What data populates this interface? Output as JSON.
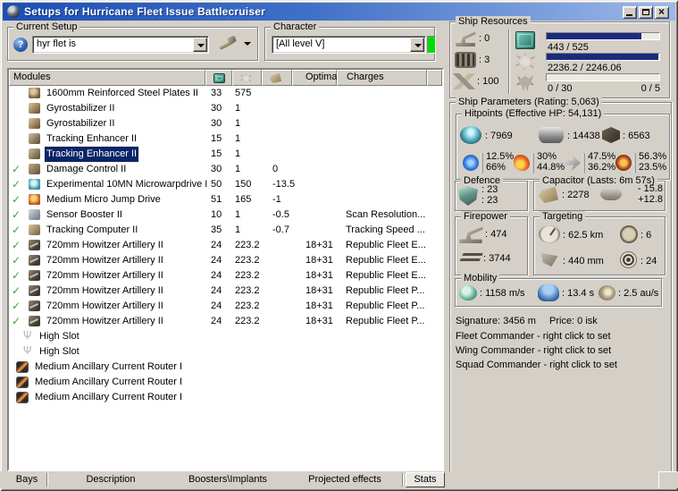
{
  "window": {
    "title": "Setups for Hurricane Fleet Issue Battlecruiser"
  },
  "setup": {
    "label": "Current Setup",
    "value": "hyr flet is"
  },
  "character": {
    "label": "Character",
    "value": "[All level V]"
  },
  "modules": {
    "headers": {
      "name": "Modules",
      "cpu_icon": "cpu-icon",
      "powergrid_icon": "powergrid-icon",
      "capacitor_icon": "capacitor-icon",
      "optimal": "Optimal",
      "charges": "Charges"
    },
    "rows": [
      {
        "check": false,
        "selected": false,
        "icon": "armor-plate",
        "name": "1600mm Reinforced Steel Plates II",
        "cpu": "33",
        "pg": "575",
        "cap": "",
        "optimal": "",
        "charges": ""
      },
      {
        "check": false,
        "selected": false,
        "icon": "gyrostabilizer",
        "name": "Gyrostabilizer II",
        "cpu": "30",
        "pg": "1",
        "cap": "",
        "optimal": "",
        "charges": ""
      },
      {
        "check": false,
        "selected": false,
        "icon": "gyrostabilizer",
        "name": "Gyrostabilizer II",
        "cpu": "30",
        "pg": "1",
        "cap": "",
        "optimal": "",
        "charges": ""
      },
      {
        "check": false,
        "selected": false,
        "icon": "tracking-enhancer",
        "name": "Tracking Enhancer II",
        "cpu": "15",
        "pg": "1",
        "cap": "",
        "optimal": "",
        "charges": ""
      },
      {
        "check": false,
        "selected": true,
        "icon": "tracking-enhancer",
        "name": "Tracking Enhancer II",
        "cpu": "15",
        "pg": "1",
        "cap": "",
        "optimal": "",
        "charges": ""
      },
      {
        "check": true,
        "selected": false,
        "icon": "damage-control",
        "name": "Damage Control II",
        "cpu": "30",
        "pg": "1",
        "cap": "0",
        "optimal": "",
        "charges": ""
      },
      {
        "check": true,
        "selected": false,
        "icon": "microwarpdrive",
        "name": "Experimental 10MN Microwarpdrive I",
        "cpu": "50",
        "pg": "150",
        "cap": "-13.5",
        "optimal": "",
        "charges": ""
      },
      {
        "check": true,
        "selected": false,
        "icon": "micro-jump-drive",
        "name": "Medium Micro Jump Drive",
        "cpu": "51",
        "pg": "165",
        "cap": "-1",
        "optimal": "",
        "charges": ""
      },
      {
        "check": true,
        "selected": false,
        "icon": "sensor-booster",
        "name": "Sensor Booster II",
        "cpu": "10",
        "pg": "1",
        "cap": "-0.5",
        "optimal": "",
        "charges": "Scan Resolution..."
      },
      {
        "check": true,
        "selected": false,
        "icon": "tracking-computer",
        "name": "Tracking Computer II",
        "cpu": "35",
        "pg": "1",
        "cap": "-0.7",
        "optimal": "",
        "charges": "Tracking Speed ..."
      },
      {
        "check": true,
        "selected": false,
        "icon": "artillery",
        "name": "720mm Howitzer Artillery II",
        "cpu": "24",
        "pg": "223.2",
        "cap": "",
        "optimal": "18+31",
        "charges": "Republic Fleet E..."
      },
      {
        "check": true,
        "selected": false,
        "icon": "artillery",
        "name": "720mm Howitzer Artillery II",
        "cpu": "24",
        "pg": "223.2",
        "cap": "",
        "optimal": "18+31",
        "charges": "Republic Fleet E..."
      },
      {
        "check": true,
        "selected": false,
        "icon": "artillery",
        "name": "720mm Howitzer Artillery II",
        "cpu": "24",
        "pg": "223.2",
        "cap": "",
        "optimal": "18+31",
        "charges": "Republic Fleet E..."
      },
      {
        "check": true,
        "selected": false,
        "icon": "artillery",
        "name": "720mm Howitzer Artillery II",
        "cpu": "24",
        "pg": "223.2",
        "cap": "",
        "optimal": "18+31",
        "charges": "Republic Fleet P..."
      },
      {
        "check": true,
        "selected": false,
        "icon": "artillery",
        "name": "720mm Howitzer Artillery II",
        "cpu": "24",
        "pg": "223.2",
        "cap": "",
        "optimal": "18+31",
        "charges": "Republic Fleet P..."
      },
      {
        "check": true,
        "selected": false,
        "icon": "artillery",
        "name": "720mm Howitzer Artillery II",
        "cpu": "24",
        "pg": "223.2",
        "cap": "",
        "optimal": "18+31",
        "charges": "Republic Fleet P..."
      },
      {
        "check": false,
        "selected": false,
        "icon": "high-slot",
        "name": "High Slot",
        "cpu": "",
        "pg": "",
        "cap": "",
        "optimal": "",
        "charges": ""
      },
      {
        "check": false,
        "selected": false,
        "icon": "high-slot",
        "name": "High Slot",
        "cpu": "",
        "pg": "",
        "cap": "",
        "optimal": "",
        "charges": ""
      },
      {
        "check": false,
        "selected": false,
        "icon": "rig",
        "name": "Medium Ancillary Current Router I",
        "cpu": "",
        "pg": "",
        "cap": "",
        "optimal": "",
        "charges": ""
      },
      {
        "check": false,
        "selected": false,
        "icon": "rig",
        "name": "Medium Ancillary Current Router I",
        "cpu": "",
        "pg": "",
        "cap": "",
        "optimal": "",
        "charges": ""
      },
      {
        "check": false,
        "selected": false,
        "icon": "rig",
        "name": "Medium Ancillary Current Router I",
        "cpu": "",
        "pg": "",
        "cap": "",
        "optimal": "",
        "charges": ""
      }
    ]
  },
  "resources": {
    "label": "Ship Resources",
    "turrets": ": 0",
    "launchers": ": 3",
    "calibration": ": 100",
    "cpu": {
      "text": "443 / 525",
      "pct": 84
    },
    "powergrid": {
      "text": "2236.2 / 2246.06",
      "pct": 99.5
    },
    "drones": {
      "text": "0 / 30",
      "bandwidth": "0 / 5",
      "pct": 0
    }
  },
  "parameters": {
    "label": "Ship Parameters (Rating: 5,063)",
    "hitpoints": {
      "label": "Hitpoints (Effective HP: 54,131)",
      "shield": ": 7969",
      "armor": ": 14438",
      "structure": ": 6563",
      "resists": [
        {
          "type": "em",
          "top": "12.5%",
          "bottom": "66%"
        },
        {
          "type": "explosive",
          "top": "30%",
          "bottom": "44.8%"
        },
        {
          "type": "kinetic",
          "top": "47.5%",
          "bottom": "36.2%"
        },
        {
          "type": "thermal",
          "top": "56.3%",
          "bottom": "23.5%"
        }
      ]
    },
    "defence": {
      "label": "Defence",
      "value1": ": 23",
      "value2": ": 23"
    },
    "capacitor": {
      "label": "Capacitor (Lasts: 6m 57s)",
      "amount": ": 2278",
      "drain": "- 15.8",
      "recharge": "+12.8"
    },
    "firepower": {
      "label": "Firepower",
      "dps": ": 474",
      "volley": ": 3744"
    },
    "targeting": {
      "label": "Targeting",
      "range": ": 62.5 km",
      "max_targets": ": 6",
      "scan_resolution": ": 440 mm",
      "sensor_strength": ": 24"
    },
    "mobility": {
      "label": "Mobility",
      "speed": ": 1158 m/s",
      "align_time": ": 13.4 s",
      "warp_speed": ": 2.5 au/s"
    },
    "info": {
      "signature": "Signature: 3456 m",
      "price": "Price: 0 isk",
      "fleet": "Fleet Commander - right click to set",
      "wing": "Wing Commander - right click to set",
      "squad": "Squad Commander - right click to set"
    }
  },
  "footer": {
    "tabs": [
      "Bays",
      "Description",
      "Boosters\\Implants",
      "Projected effects",
      "Stats"
    ],
    "active": "Stats"
  }
}
